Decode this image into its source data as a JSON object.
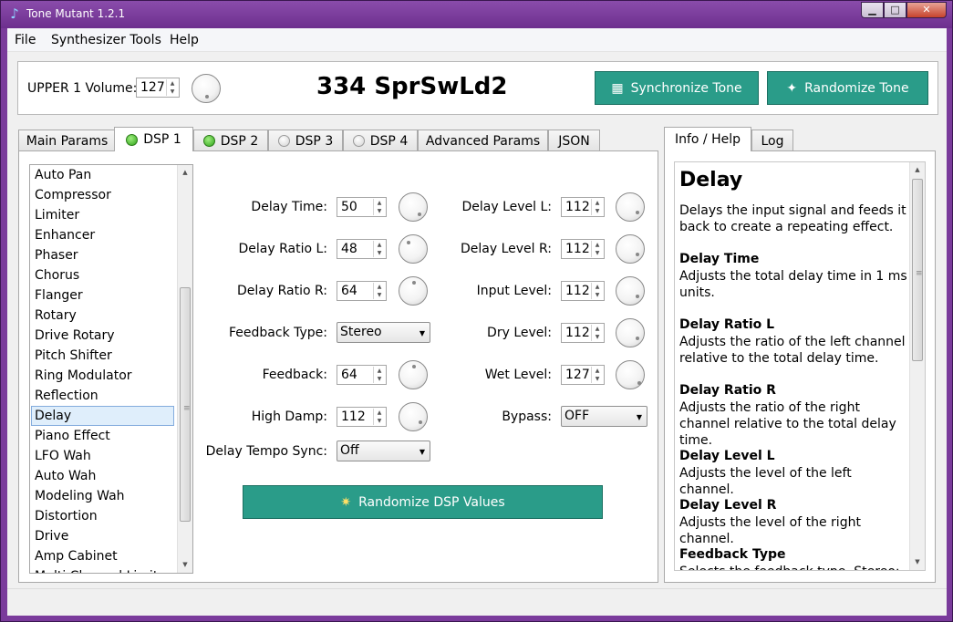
{
  "window": {
    "title": "Tone Mutant 1.2.1",
    "minimize": "▁",
    "maximize": "□",
    "close": "✕"
  },
  "menu": {
    "file": "File",
    "synth_tools": "Synthesizer Tools",
    "help": "Help"
  },
  "top": {
    "volume_label": "UPPER 1 Volume:",
    "volume_value": "127",
    "preset_name": "334 SprSwLd2",
    "sync_button": "Synchronize Tone",
    "randomize_button": "Randomize Tone"
  },
  "tabs": [
    {
      "label": "Main Params"
    },
    {
      "label": "DSP 1",
      "led": "on",
      "active": true
    },
    {
      "label": "DSP 2",
      "led": "on"
    },
    {
      "label": "DSP 3",
      "led": "off"
    },
    {
      "label": "DSP 4",
      "led": "off"
    },
    {
      "label": "Advanced Params"
    },
    {
      "label": "JSON"
    }
  ],
  "effects": [
    "Auto Pan",
    "Compressor",
    "Limiter",
    "Enhancer",
    "Phaser",
    "Chorus",
    "Flanger",
    "Rotary",
    "Drive Rotary",
    "Pitch Shifter",
    "Ring Modulator",
    "Reflection",
    "Delay",
    "Piano Effect",
    "LFO Wah",
    "Auto Wah",
    "Modeling Wah",
    "Distortion",
    "Drive",
    "Amp Cabinet",
    "Multi Channel Limiter"
  ],
  "selected_effect": "Delay",
  "params_left": {
    "delay_time": {
      "label": "Delay Time:",
      "value": "50"
    },
    "delay_ratio_l": {
      "label": "Delay Ratio L:",
      "value": "48"
    },
    "delay_ratio_r": {
      "label": "Delay Ratio R:",
      "value": "64"
    },
    "feedback_type": {
      "label": "Feedback Type:",
      "value": "Stereo"
    },
    "feedback": {
      "label": "Feedback:",
      "value": "64"
    },
    "high_damp": {
      "label": "High Damp:",
      "value": "112"
    },
    "tempo_sync": {
      "label": "Delay Tempo Sync:",
      "value": "Off"
    }
  },
  "params_right": {
    "delay_level_l": {
      "label": "Delay Level L:",
      "value": "112"
    },
    "delay_level_r": {
      "label": "Delay Level R:",
      "value": "112"
    },
    "input_level": {
      "label": "Input Level:",
      "value": "112"
    },
    "dry_level": {
      "label": "Dry Level:",
      "value": "112"
    },
    "wet_level": {
      "label": "Wet Level:",
      "value": "127"
    },
    "bypass": {
      "label": "Bypass:",
      "value": "OFF"
    }
  },
  "randomize_dsp_button": "Randomize DSP Values",
  "info_tabs": {
    "help": "Info / Help",
    "log": "Log"
  },
  "info": {
    "title": "Delay",
    "intro": "Delays the input signal and feeds it back to create a repeating effect.",
    "sections": [
      {
        "head": "Delay Time",
        "text": "Adjusts the total delay time in 1 ms units."
      },
      {
        "head": "Delay Ratio L",
        "text": "Adjusts the ratio of the left channel relative to the total delay time."
      },
      {
        "head": "Delay Ratio R",
        "text": "Adjusts the ratio of the right channel relative to the total delay time."
      },
      {
        "head": "Delay Level L",
        "text": "Adjusts the level of the left channel."
      },
      {
        "head": "Delay Level R",
        "text": "Adjusts the level of the right channel."
      },
      {
        "head": "Feedback Type",
        "text": "Selects the feedback type. Stereo:"
      }
    ]
  },
  "colors": {
    "accent": "#2a9c89",
    "titlebar": "#7a3b9b",
    "led_on": "#2ea318"
  }
}
